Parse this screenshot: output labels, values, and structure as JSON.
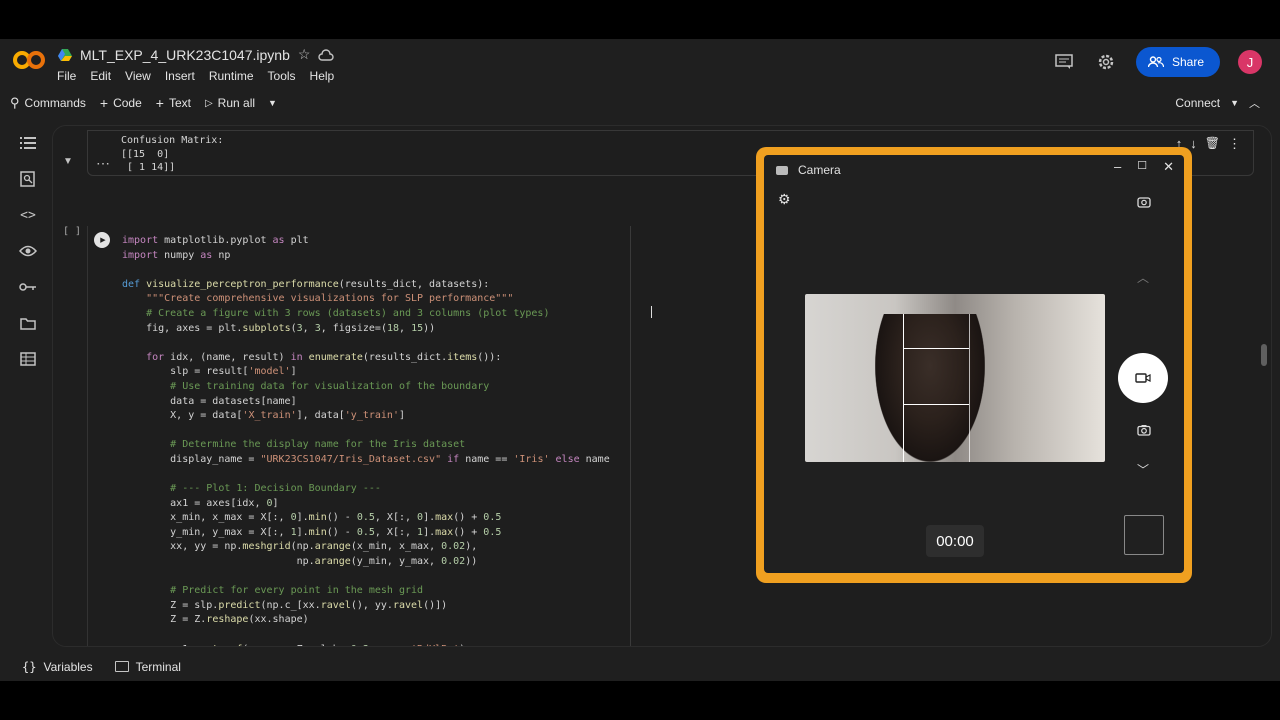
{
  "app": {
    "file_name": "MLT_EXP_4_URK23C1047.ipynb"
  },
  "menu": [
    "File",
    "Edit",
    "View",
    "Insert",
    "Runtime",
    "Tools",
    "Help"
  ],
  "header": {
    "share_label": "Share",
    "avatar_letter": "J"
  },
  "toolbar": {
    "commands": "Commands",
    "code": "Code",
    "text": "Text",
    "run_all": "Run all",
    "connect": "Connect"
  },
  "output": {
    "lines": [
      "Confusion Matrix:",
      "[[15  0]",
      " [ 1 14]]"
    ]
  },
  "cell": {
    "exec_count": "[ ]"
  },
  "bottom": {
    "variables": "Variables",
    "terminal": "Terminal"
  },
  "camera": {
    "title": "Camera",
    "timer": "00:00"
  },
  "colors": {
    "share_bg": "#0b57d0",
    "avatar_bg": "#d93667",
    "camera_border": "#f0a020",
    "logo": "#f9ab00"
  }
}
